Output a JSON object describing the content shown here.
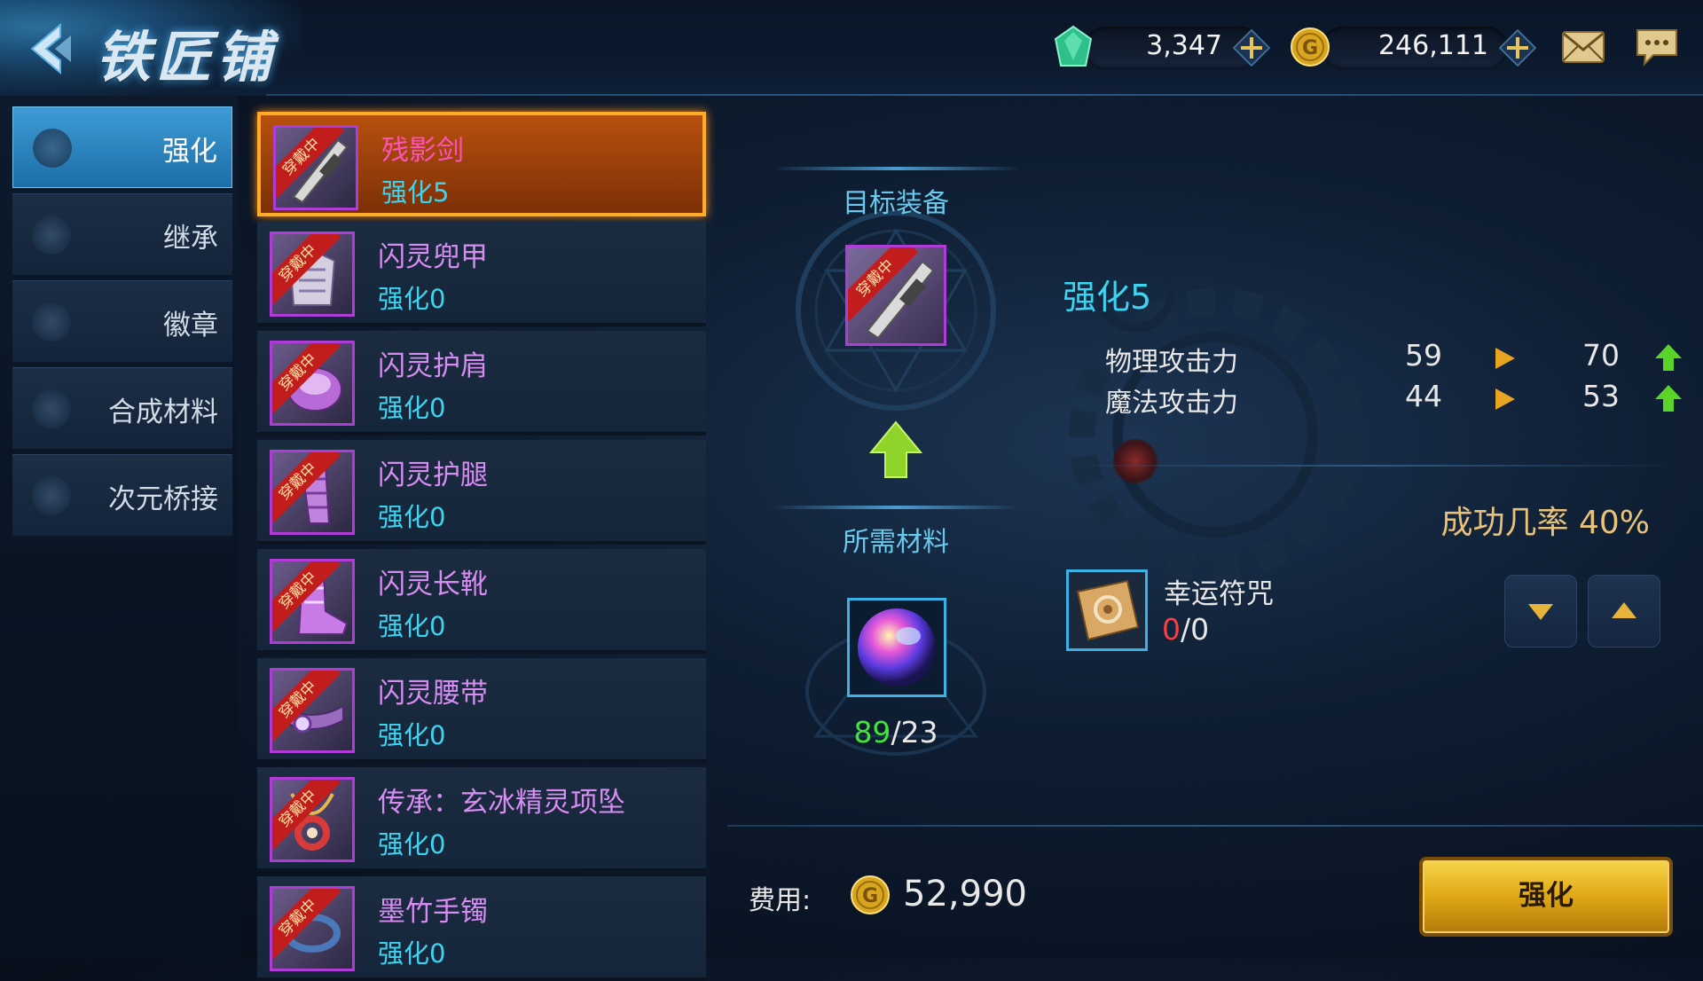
{
  "header": {
    "title": "铁匠铺",
    "gems": "3,347",
    "gold": "246,111"
  },
  "tabs": [
    {
      "label": "强化",
      "active": true
    },
    {
      "label": "继承"
    },
    {
      "label": "徽章"
    },
    {
      "label": "合成材料"
    },
    {
      "label": "次元桥接"
    }
  ],
  "equip_list": [
    {
      "name": "残影剑",
      "level": "强化5",
      "tag": "穿戴中"
    },
    {
      "name": "闪灵兜甲",
      "level": "强化0",
      "tag": "穿戴中"
    },
    {
      "name": "闪灵护肩",
      "level": "强化0",
      "tag": "穿戴中"
    },
    {
      "name": "闪灵护腿",
      "level": "强化0",
      "tag": "穿戴中"
    },
    {
      "name": "闪灵长靴",
      "level": "强化0",
      "tag": "穿戴中"
    },
    {
      "name": "闪灵腰带",
      "level": "强化0",
      "tag": "穿戴中"
    },
    {
      "name": "传承：玄冰精灵项坠",
      "level": "强化0",
      "tag": "穿戴中"
    },
    {
      "name": "墨竹手镯",
      "level": "强化0",
      "tag": "穿戴中"
    }
  ],
  "target": {
    "section_title": "目标装备",
    "tag": "穿戴中",
    "level": "强化5",
    "stats": [
      {
        "label": "物理攻击力",
        "from": "59",
        "to": "70"
      },
      {
        "label": "魔法攻击力",
        "from": "44",
        "to": "53"
      }
    ]
  },
  "materials": {
    "section_title": "所需材料",
    "owned": "89",
    "required": "/23"
  },
  "success": {
    "label": "成功几率",
    "value": "40%"
  },
  "charm": {
    "name": "幸运符咒",
    "used": "0",
    "total": "/0"
  },
  "cost": {
    "label": "费用:",
    "value": "52,990"
  },
  "action_label": "强化",
  "colors": {
    "accent_cyan": "#3cd4f0",
    "rarity_purple": "#b03cd8",
    "selected_orange": "#ffab2a",
    "owned_green": "#44e23c",
    "zero_red": "#ff3c3c",
    "gold_button": "#e8b416"
  }
}
